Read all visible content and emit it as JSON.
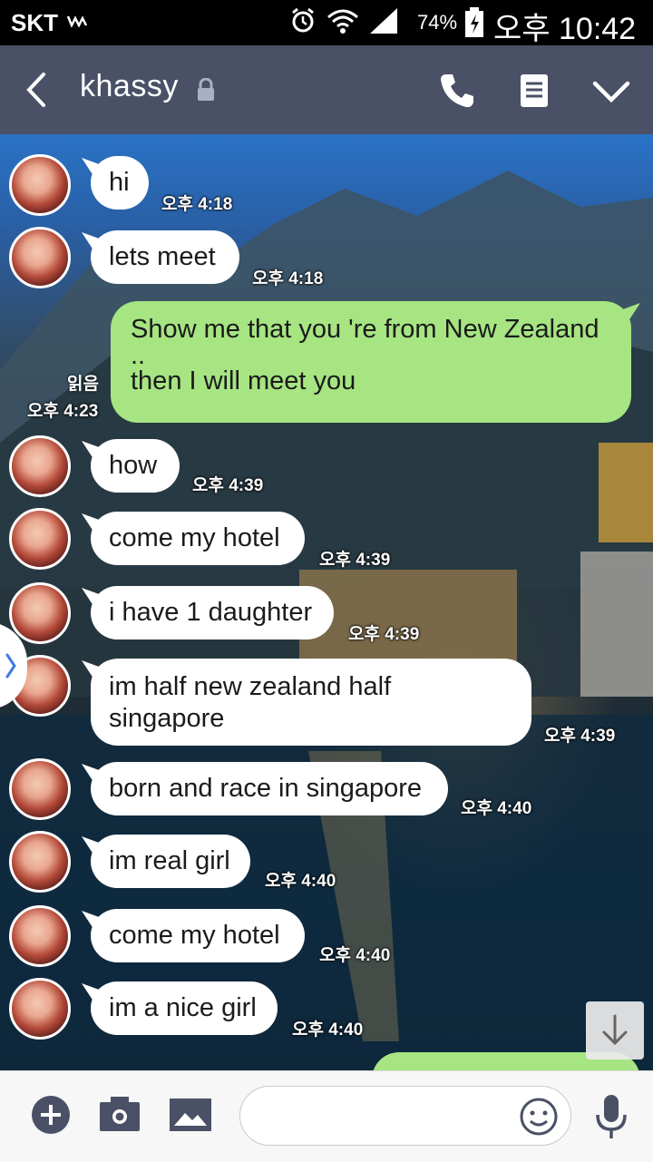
{
  "status_bar": {
    "carrier": "SKT",
    "battery": "74%",
    "time": "오후 10:42"
  },
  "header": {
    "title": "khassy"
  },
  "messages": [
    {
      "dir": "in",
      "text": "hi",
      "time": "오후 4:18"
    },
    {
      "dir": "in",
      "text": "lets meet",
      "time": "오후 4:18"
    },
    {
      "dir": "out",
      "text_lines": [
        "Show me that you 're from New Zealand",
        "..",
        "then I will meet you"
      ],
      "read": "읽음",
      "time": "오후 4:23"
    },
    {
      "dir": "in",
      "text": "how",
      "time": "오후 4:39"
    },
    {
      "dir": "in",
      "text": "come my hotel",
      "time": "오후 4:39"
    },
    {
      "dir": "in",
      "text": "i have 1 daughter",
      "time": "오후 4:39"
    },
    {
      "dir": "in",
      "text_lines": [
        "im half new zealand half",
        "singapore"
      ],
      "time": "오후 4:39"
    },
    {
      "dir": "in",
      "text": "born and race in singapore",
      "time": "오후 4:40"
    },
    {
      "dir": "in",
      "text": "im real girl",
      "time": "오후 4:40"
    },
    {
      "dir": "in",
      "text": "come my hotel",
      "time": "오후 4:40"
    },
    {
      "dir": "in",
      "text": "im a nice girl",
      "time": "오후 4:40"
    }
  ],
  "input": {
    "value": "",
    "placeholder": ""
  },
  "icons": {
    "header": [
      "back-icon",
      "lock-icon",
      "phone-icon",
      "notes-icon",
      "chevron-down-icon"
    ],
    "input_bar": [
      "add-icon",
      "camera-icon",
      "image-icon",
      "emoji-icon",
      "mic-icon"
    ]
  },
  "colors": {
    "header_bg": "#4a5066",
    "outgoing_bubble": "#a6e582",
    "incoming_bubble": "#ffffff"
  }
}
